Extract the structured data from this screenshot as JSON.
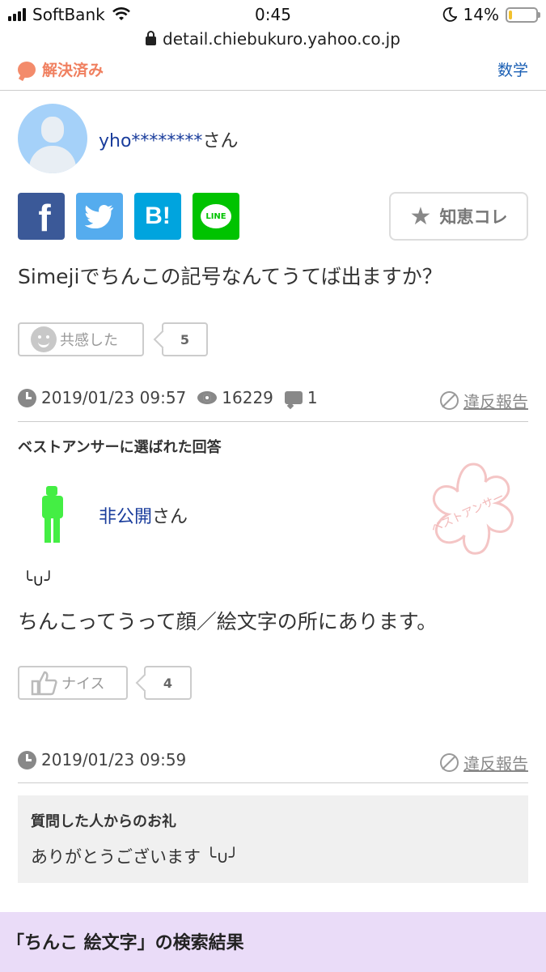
{
  "status": {
    "carrier": "SoftBank",
    "time": "0:45",
    "battery": "14%",
    "battery_level": 0.14,
    "url": "detail.chiebukuro.yahoo.co.jp"
  },
  "header": {
    "resolved": "解決済み",
    "category": "数学"
  },
  "question": {
    "user_name": "yho********",
    "user_suffix": "さん",
    "chie_button": "知恵コレ",
    "text": "Simejiでちんこの記号なんてうてば出ますか？",
    "empathy_label": "共感した",
    "empathy_count": "5",
    "datetime": "2019/01/23 09:57",
    "views": "16229",
    "answers": "1",
    "report": "違反報告"
  },
  "best_answer": {
    "heading": "ベストアンサーに選ばれた回答",
    "user_name": "非公開",
    "user_suffix": "さん",
    "stamp_text": "ベストアンサー",
    "emoji_line": "╰∪╯",
    "text": "ちんこってうって顔／絵文字の所にあります。",
    "nice_label": "ナイス",
    "nice_count": "4",
    "datetime": "2019/01/23 09:59",
    "report": "違反報告"
  },
  "thanks": {
    "heading": "質問した人からのお礼",
    "text": "ありがとうございます ╰∪╯"
  },
  "search": {
    "title": "「ちんこ 絵文字」の検索結果"
  },
  "colors": {
    "accent_link": "#1a3d9c",
    "resolved": "#f08060",
    "facebook": "#3b5998",
    "twitter": "#55acee",
    "hatena": "#00a4de",
    "line": "#00c300",
    "search_bg": "#eadcf8"
  }
}
